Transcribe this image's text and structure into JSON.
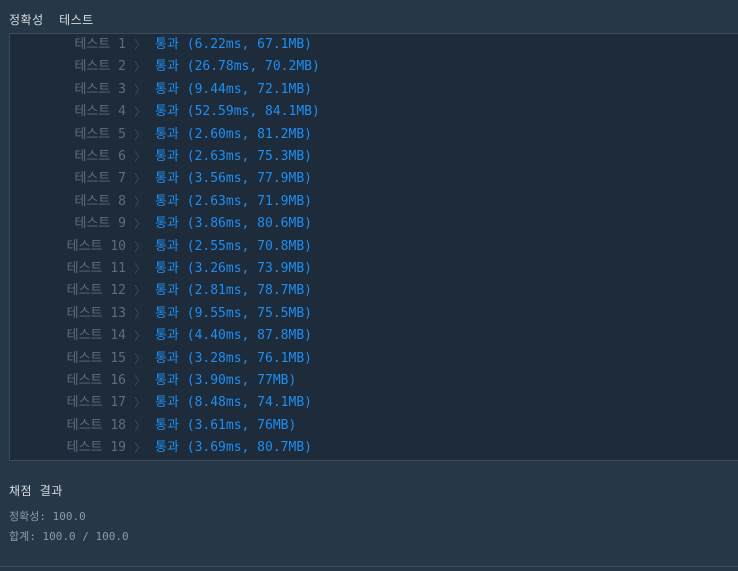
{
  "header": {
    "title": "정확성  테스트"
  },
  "tests": [
    {
      "label": "테스트 1",
      "result": "통과 (6.22ms, 67.1MB)"
    },
    {
      "label": "테스트 2",
      "result": "통과 (26.78ms, 70.2MB)"
    },
    {
      "label": "테스트 3",
      "result": "통과 (9.44ms, 72.1MB)"
    },
    {
      "label": "테스트 4",
      "result": "통과 (52.59ms, 84.1MB)"
    },
    {
      "label": "테스트 5",
      "result": "통과 (2.60ms, 81.2MB)"
    },
    {
      "label": "테스트 6",
      "result": "통과 (2.63ms, 75.3MB)"
    },
    {
      "label": "테스트 7",
      "result": "통과 (3.56ms, 77.9MB)"
    },
    {
      "label": "테스트 8",
      "result": "통과 (2.63ms, 71.9MB)"
    },
    {
      "label": "테스트 9",
      "result": "통과 (3.86ms, 80.6MB)"
    },
    {
      "label": "테스트 10",
      "result": "통과 (2.55ms, 70.8MB)"
    },
    {
      "label": "테스트 11",
      "result": "통과 (3.26ms, 73.9MB)"
    },
    {
      "label": "테스트 12",
      "result": "통과 (2.81ms, 78.7MB)"
    },
    {
      "label": "테스트 13",
      "result": "통과 (9.55ms, 75.5MB)"
    },
    {
      "label": "테스트 14",
      "result": "통과 (4.40ms, 87.8MB)"
    },
    {
      "label": "테스트 15",
      "result": "통과 (3.28ms, 76.1MB)"
    },
    {
      "label": "테스트 16",
      "result": "통과 (3.90ms, 77MB)"
    },
    {
      "label": "테스트 17",
      "result": "통과 (8.48ms, 74.1MB)"
    },
    {
      "label": "테스트 18",
      "result": "통과 (3.61ms, 76MB)"
    },
    {
      "label": "테스트 19",
      "result": "통과 (3.69ms, 80.7MB)"
    }
  ],
  "summary": {
    "title": "채점 결과",
    "accuracy": "정확성: 100.0",
    "total": "합계: 100.0 / 100.0"
  },
  "colors": {
    "background": "#263747",
    "panel": "#1e2b3a",
    "pass": "#1f8ef1",
    "label": "#5c6d7e"
  },
  "icons": {
    "row_chevron": "chevron-right-icon"
  }
}
